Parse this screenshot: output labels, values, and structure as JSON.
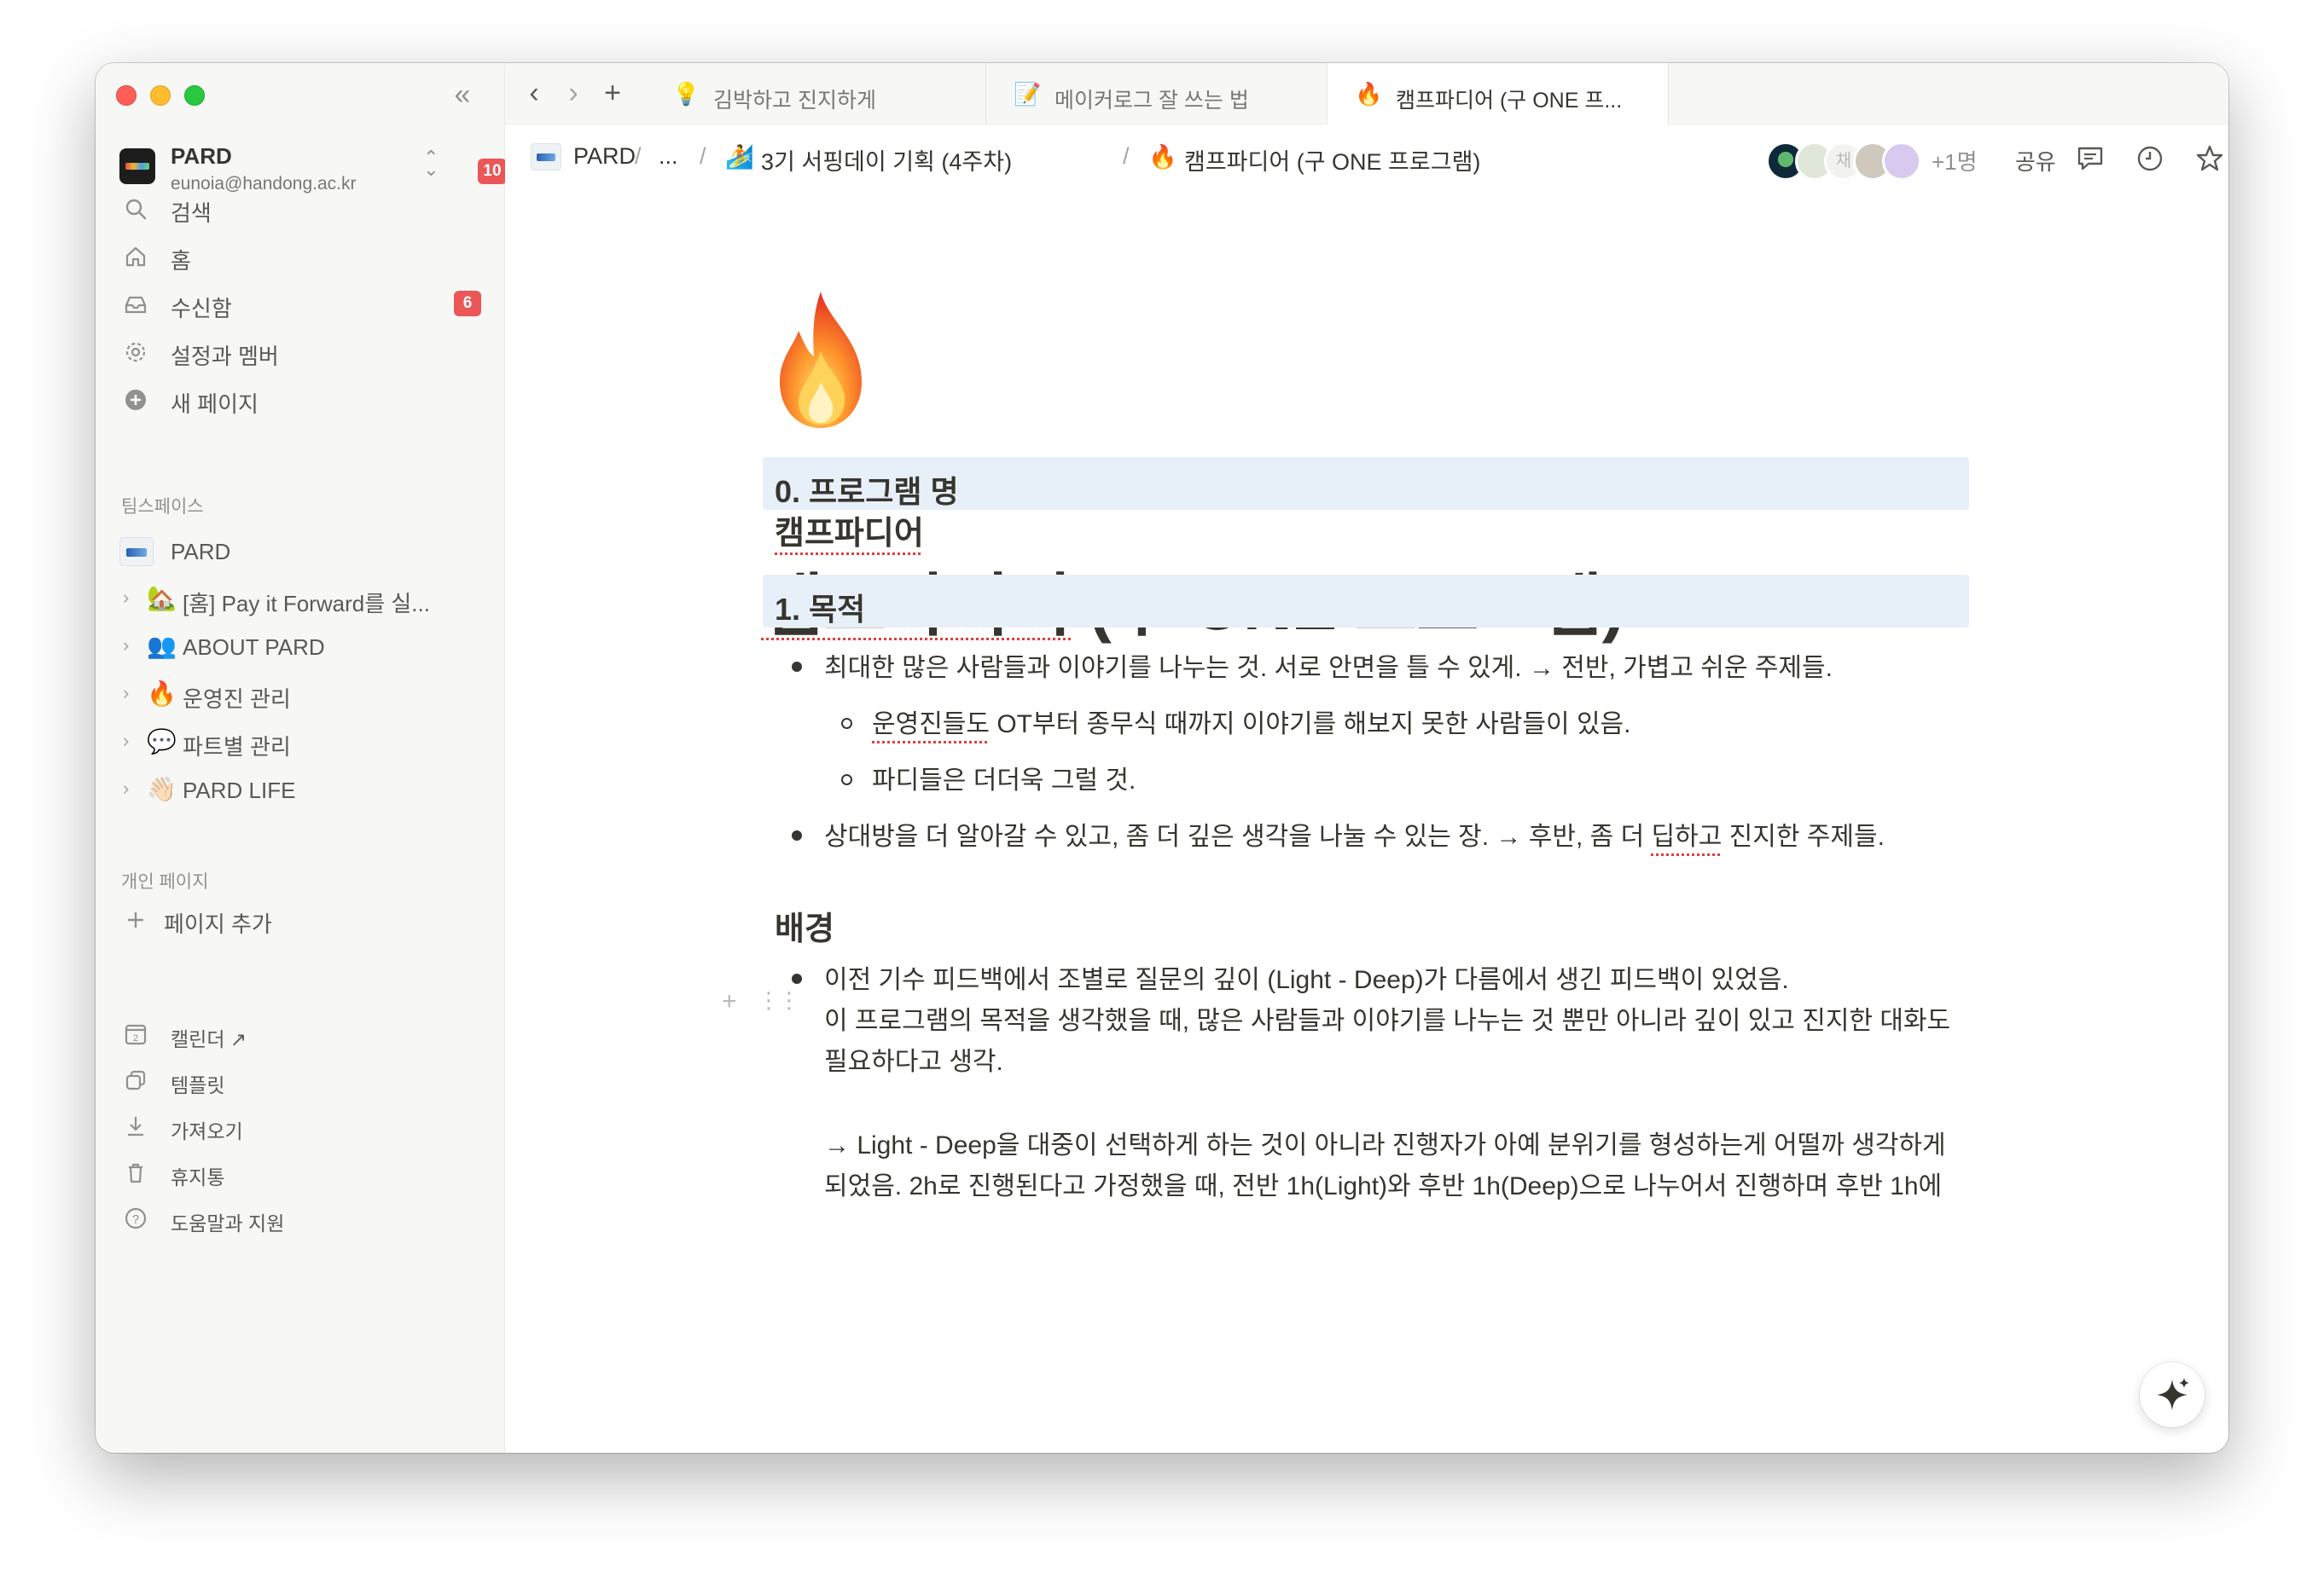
{
  "sidebar": {
    "workspace": {
      "name": "PARD",
      "email": "eunoia@handong.ac.kr",
      "badge": "10"
    },
    "nav": [
      {
        "label": "검색",
        "icon": "search-icon"
      },
      {
        "label": "홈",
        "icon": "home-icon"
      },
      {
        "label": "수신함",
        "icon": "inbox-icon",
        "badge": "6"
      },
      {
        "label": "설정과 멤버",
        "icon": "gear-icon"
      },
      {
        "label": "새 페이지",
        "icon": "plus-circle-icon"
      }
    ],
    "teamspace_label": "팀스페이스",
    "teamspace_root": "PARD",
    "tree": [
      {
        "emoji": "🏡",
        "label": "[홈] Pay it Forward를 실..."
      },
      {
        "emoji": "👥",
        "label": "ABOUT PARD"
      },
      {
        "emoji": "🔥",
        "label": "운영진 관리"
      },
      {
        "emoji": "💬",
        "label": "파트별 관리"
      },
      {
        "emoji": "👋🏻",
        "label": "PARD LIFE"
      }
    ],
    "private_label": "개인 페이지",
    "add_page": "페이지 추가",
    "bottom": [
      {
        "label": "캘린더 ↗",
        "icon": "calendar-icon",
        "icon_text": "2"
      },
      {
        "label": "템플릿",
        "icon": "template-icon"
      },
      {
        "label": "가져오기",
        "icon": "download-icon"
      },
      {
        "label": "휴지통",
        "icon": "trash-icon"
      },
      {
        "label": "도움말과 지원",
        "icon": "help-icon"
      }
    ]
  },
  "tabs": [
    {
      "emoji": "💡",
      "label": "김박하고 진지하게"
    },
    {
      "emoji": "📝",
      "label": "메이커로그 잘 쓰는 법"
    },
    {
      "emoji": "🔥",
      "label": "캠프파디어 (구 ONE 프...",
      "active": true
    }
  ],
  "breadcrumb": {
    "root": "PARD",
    "ellipsis": "...",
    "parent_emoji": "🏄",
    "parent": "3기 서핑데이 기획 (4주차)",
    "current_emoji": "🔥",
    "current": "캠프파디어 (구 ONE 프로그램)",
    "sep": "/"
  },
  "topbar": {
    "avatar_initial": "채",
    "more_users": "+1명",
    "share": "공유"
  },
  "page": {
    "icon": "fire-icon",
    "title_part1": "캠프파디어",
    "title_part2": " (구 ONE 프로그램)",
    "section0": "0. 프로그램 명",
    "program_name": "캠프파디어",
    "section1": "1. 목적",
    "bullets": {
      "b1": "최대한 많은 사람들과 이야기를 나누는 것. 서로 안면을 틀 수 있게. → 전반, 가볍고 쉬운 주제들.",
      "b1a_pre": "운영진들도",
      "b1a_mid": " OT부터 ",
      "b1a_post": "종무식 때까지 이야기를 해보지 못한 사람들이 있음.",
      "b1b": "파디들은 더더욱 그럴 것.",
      "b2_pre": "상대방을 더 알아갈 수 있고, 좀 더 깊은 생각을 나눌 수 있는 장. → 후반, 좀 더 ",
      "b2_sq": "딥하고",
      "b2_post": " 진지한 주제들."
    },
    "background_heading": "배경",
    "background": {
      "line1": "이전 기수 피드백에서 조별로 질문의 깊이 (Light - Deep)가 다름에서 생긴 피드백이 있었음.",
      "line2": "이 프로그램의 목적을 생각했을 때, 많은 사람들과 이야기를 나누는 것 뿐만 아니라 깊이 있고 진지한 대화도",
      "line3": "필요하다고 생각.",
      "line4": "→ Light - Deep을 대중이 선택하게 하는 것이 아니라 진행자가 아예 분위기를 형성하는게 어떨까 생각하게",
      "line5": "되었음. 2h로 진행된다고 가정했을 때, 전반 1h(Light)와 후반 1h(Deep)으로 나누어서 진행하며 후반 1h에"
    }
  }
}
